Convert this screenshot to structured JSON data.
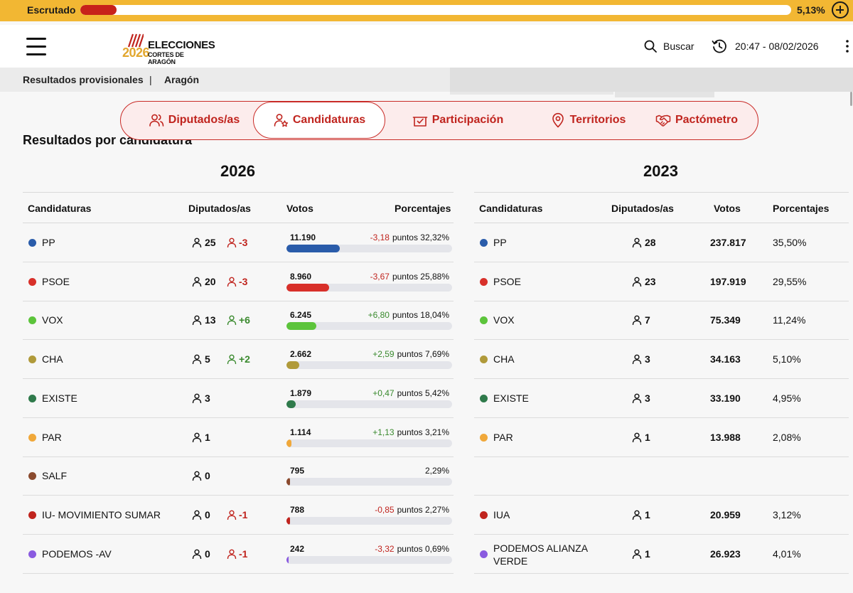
{
  "progress": {
    "label": "Escrutado",
    "value_text": "5,13%",
    "fraction": 0.0513
  },
  "header": {
    "logo_year": "2026",
    "logo_title": "ELECCIONES",
    "logo_subtitle": "CORTES DE ARAGÓN",
    "search_label": "Buscar",
    "datetime": "20:47 - 08/02/2026"
  },
  "breadcrumb": {
    "first": "Resultados provisionales",
    "separator": "|",
    "second": "Aragón"
  },
  "tabs": [
    {
      "label": "Diputados/as",
      "icon": "users-icon"
    },
    {
      "label": "Candidaturas",
      "icon": "user-star-icon"
    },
    {
      "label": "Participación",
      "icon": "ballot-check-icon"
    },
    {
      "label": "Territorios",
      "icon": "map-pin-icon"
    },
    {
      "label": "Pactómetro",
      "icon": "handshake-icon"
    }
  ],
  "section_title": "Resultados por candidatura",
  "columns_2026": [
    "Candidaturas",
    "Diputados/as",
    "Votos",
    "Porcentajes"
  ],
  "columns_2023": [
    "Candidaturas",
    "Diputados/as",
    "Votos",
    "Porcentajes"
  ],
  "year_2026": "2026",
  "year_2023": "2023",
  "colors": {
    "accent": "#c0241e",
    "gold": "#f2b733"
  },
  "results_2026": [
    {
      "party": "PP",
      "color": "#2a5caa",
      "seats": "25",
      "seat_delta": "-3",
      "delta_dir": "down",
      "votes": "11.190",
      "change": "-3,18",
      "change_dir": "down",
      "pct": "puntos 32,32%",
      "share": 32.32
    },
    {
      "party": "PSOE",
      "color": "#d8302a",
      "seats": "20",
      "seat_delta": "-3",
      "delta_dir": "down",
      "votes": "8.960",
      "change": "-3,67",
      "change_dir": "down",
      "pct": "puntos 25,88%",
      "share": 25.88
    },
    {
      "party": "VOX",
      "color": "#5cc43b",
      "seats": "13",
      "seat_delta": "+6",
      "delta_dir": "up",
      "votes": "6.245",
      "change": "+6,80",
      "change_dir": "up",
      "pct": "puntos 18,04%",
      "share": 18.04
    },
    {
      "party": "CHA",
      "color": "#b09a3a",
      "seats": "5",
      "seat_delta": "+2",
      "delta_dir": "up",
      "votes": "2.662",
      "change": "+2,59",
      "change_dir": "up",
      "pct": "puntos 7,69%",
      "share": 7.69
    },
    {
      "party": "EXISTE",
      "color": "#2f7a4b",
      "seats": "3",
      "seat_delta": "",
      "delta_dir": "",
      "votes": "1.879",
      "change": "+0,47",
      "change_dir": "up",
      "pct": "puntos 5,42%",
      "share": 5.42
    },
    {
      "party": "PAR",
      "color": "#f0a83a",
      "seats": "1",
      "seat_delta": "",
      "delta_dir": "",
      "votes": "1.114",
      "change": "+1,13",
      "change_dir": "up",
      "pct": "puntos 3,21%",
      "share": 3.21
    },
    {
      "party": "SALF",
      "color": "#8a4a2e",
      "seats": "0",
      "seat_delta": "",
      "delta_dir": "",
      "votes": "795",
      "change": "",
      "change_dir": "",
      "pct": "2,29%",
      "share": 2.29
    },
    {
      "party": "IU- MOVIMIENTO SUMAR",
      "color": "#c0241e",
      "seats": "0",
      "seat_delta": "-1",
      "delta_dir": "down",
      "votes": "788",
      "change": "-0,85",
      "change_dir": "down",
      "pct": "puntos 2,27%",
      "share": 2.27
    },
    {
      "party": "PODEMOS -AV",
      "color": "#8a5be0",
      "seats": "0",
      "seat_delta": "-1",
      "delta_dir": "down",
      "votes": "242",
      "change": "-3,32",
      "change_dir": "down",
      "pct": "puntos 0,69%",
      "share": 0.69
    }
  ],
  "results_2023": [
    {
      "party": "PP",
      "color": "#2a5caa",
      "seats": "28",
      "votes": "237.817",
      "pct": "35,50%"
    },
    {
      "party": "PSOE",
      "color": "#d8302a",
      "seats": "23",
      "votes": "197.919",
      "pct": "29,55%"
    },
    {
      "party": "VOX",
      "color": "#5cc43b",
      "seats": "7",
      "votes": "75.349",
      "pct": "11,24%"
    },
    {
      "party": "CHA",
      "color": "#b09a3a",
      "seats": "3",
      "votes": "34.163",
      "pct": "5,10%"
    },
    {
      "party": "EXISTE",
      "color": "#2f7a4b",
      "seats": "3",
      "votes": "33.190",
      "pct": "4,95%"
    },
    {
      "party": "PAR",
      "color": "#f0a83a",
      "seats": "1",
      "votes": "13.988",
      "pct": "2,08%"
    },
    null,
    {
      "party": "IUA",
      "color": "#c0241e",
      "seats": "1",
      "votes": "20.959",
      "pct": "3,12%"
    },
    {
      "party": "PODEMOS ALIANZA VERDE",
      "color": "#8a5be0",
      "seats": "1",
      "votes": "26.923",
      "pct": "4,01%"
    }
  ]
}
